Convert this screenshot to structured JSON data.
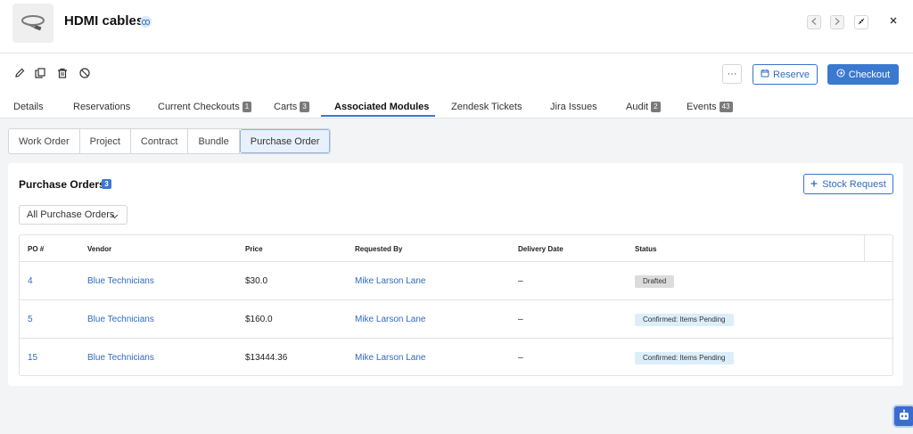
{
  "header": {
    "title": "HDMI cables",
    "thumbnail_icon": "cable-icon",
    "nav_prev_icon": "chevron-left-icon",
    "nav_next_icon": "chevron-right-icon",
    "collapse_icon": "collapse-icon",
    "close_icon": "close-icon"
  },
  "toolbar": {
    "icons": [
      "pencil-icon",
      "copy-icon",
      "trash-icon",
      "ban-icon"
    ],
    "more_label": "···",
    "reserve_label": "Reserve",
    "checkout_label": "Checkout"
  },
  "tabs": [
    {
      "label": "Details",
      "count": null
    },
    {
      "label": "Reservations",
      "count": null
    },
    {
      "label": "Current Checkouts",
      "count": "1"
    },
    {
      "label": "Carts",
      "count": "3"
    },
    {
      "label": "Associated Modules",
      "count": null,
      "active": true
    },
    {
      "label": "Zendesk Tickets",
      "count": null
    },
    {
      "label": "Jira Issues",
      "count": null
    },
    {
      "label": "Audit",
      "count": "2"
    },
    {
      "label": "Events",
      "count": "43"
    }
  ],
  "subtabs": [
    "Work Order",
    "Project",
    "Contract",
    "Bundle",
    "Purchase Order"
  ],
  "active_subtab": "Purchase Order",
  "purchase_orders": {
    "title": "Purchase Orders",
    "count": "3",
    "stock_request_label": "Stock Request",
    "filter_value": "All Purchase Orders",
    "columns": [
      "PO #",
      "Vendor",
      "Price",
      "Requested By",
      "Delivery Date",
      "Status"
    ],
    "rows": [
      {
        "po": "4",
        "vendor": "Blue Technicians",
        "price": "$30.0",
        "requested_by": "Mike Larson Lane",
        "delivery_date": "–",
        "status": "Drafted",
        "status_kind": "drafted"
      },
      {
        "po": "5",
        "vendor": "Blue Technicians",
        "price": "$160.0",
        "requested_by": "Mike Larson Lane",
        "delivery_date": "–",
        "status": "Confirmed: Items Pending",
        "status_kind": "confirmed"
      },
      {
        "po": "15",
        "vendor": "Blue Technicians",
        "price": "$13444.36",
        "requested_by": "Mike Larson Lane",
        "delivery_date": "–",
        "status": "Confirmed: Items Pending",
        "status_kind": "confirmed"
      }
    ]
  },
  "colors": {
    "accent": "#3b79d0",
    "link": "#2f6bbf",
    "drafted_bg": "#dcdcdc",
    "confirmed_bg": "#dceefa"
  },
  "assistant_icon": "robot-icon"
}
